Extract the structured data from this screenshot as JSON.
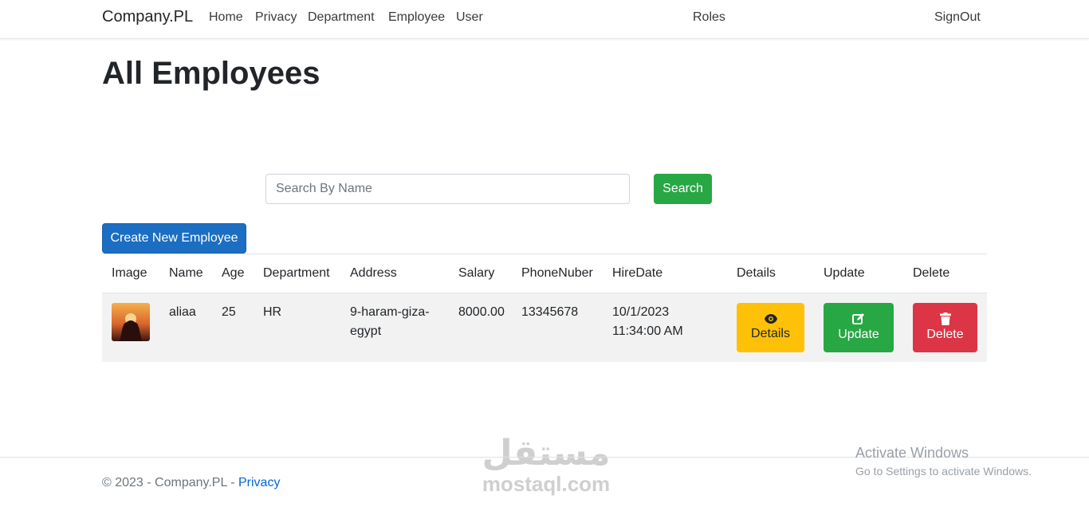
{
  "nav": {
    "brand": "Company.PL",
    "links": [
      "Home",
      "Privacy",
      "Department",
      "Employee",
      "User"
    ],
    "roles": "Roles",
    "signout": "SignOut"
  },
  "page": {
    "title": "All Employees"
  },
  "search": {
    "placeholder": "Search By Name",
    "value": "",
    "button": "Search"
  },
  "create_button": "Create New Employee",
  "table": {
    "headers": [
      "Image",
      "Name",
      "Age",
      "Department",
      "Address",
      "Salary",
      "PhoneNuber",
      "HireDate",
      "Details",
      "Update",
      "Delete"
    ],
    "rows": [
      {
        "name": "aliaa",
        "age": "25",
        "department": "HR",
        "address_line1": "9-haram-giza-",
        "address_line2": "egypt",
        "salary": "8000.00",
        "phone": "13345678",
        "hire_date": "10/1/2023",
        "hire_time": "11:34:00 AM",
        "details_label": "Details",
        "update_label": "Update",
        "delete_label": "Delete"
      }
    ]
  },
  "footer": {
    "copyright": "© 2023 - Company.PL - ",
    "privacy": "Privacy"
  },
  "watermark": {
    "arabic": "مستقل",
    "latin": "mostaql.com"
  },
  "os_notice": {
    "title": "Activate Windows",
    "subtitle": "Go to Settings to activate Windows."
  },
  "colors": {
    "primary": "#1b6ec2",
    "success": "#28a745",
    "warning": "#ffc107",
    "danger": "#dc3545",
    "link": "#0366d6"
  }
}
